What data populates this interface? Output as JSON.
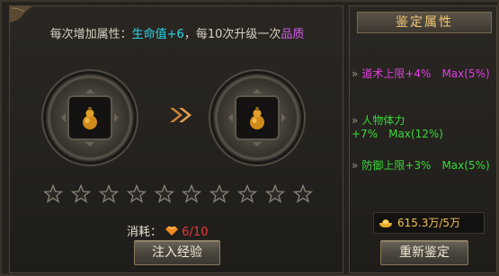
{
  "info": {
    "prefix": "每次增加属性：",
    "stat": "生命值+6",
    "middle": "，每10次升级一次",
    "quality": "品质"
  },
  "stars": {
    "filled": 0,
    "total": 10
  },
  "cost": {
    "label": "消耗：",
    "value": "6/10"
  },
  "inject_button": "注入经验",
  "panel": {
    "title": "鉴定属性",
    "attributes": [
      {
        "text": "道术上限+4%",
        "max": "Max(5%)",
        "color": "#e040e0"
      },
      {
        "text": "人物体力+7%",
        "max": "Max(12%)",
        "color": "#3ad83a"
      },
      {
        "text": "防御上限+3%",
        "max": "Max(5%)",
        "color": "#3ad83a"
      }
    ],
    "gold": "615.3万/5万",
    "reidentify_button": "重新鉴定"
  },
  "colors": {
    "cyan": "#2ad7e8",
    "purple": "#d45ce8",
    "green": "#3ad83a",
    "magenta": "#e040e0",
    "gold": "#f0c050"
  }
}
